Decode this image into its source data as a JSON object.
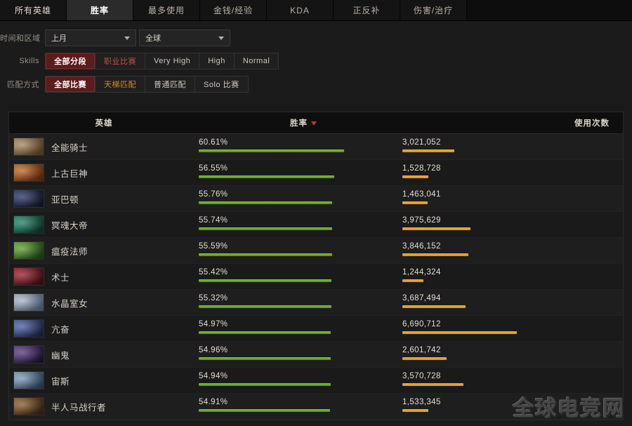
{
  "tabs": [
    {
      "label": "所有英雄",
      "active": false
    },
    {
      "label": "胜率",
      "active": true
    },
    {
      "label": "最多使用",
      "active": false
    },
    {
      "label": "金钱/经验",
      "active": false
    },
    {
      "label": "KDA",
      "active": false
    },
    {
      "label": "正反补",
      "active": false
    },
    {
      "label": "伤害/治疗",
      "active": false
    }
  ],
  "filters": {
    "time_region": {
      "label": "时间和区域",
      "period": {
        "value": "上月"
      },
      "region": {
        "value": "全球"
      }
    },
    "skills": {
      "label": "Skills",
      "options": [
        {
          "label": "全部分段",
          "state": "active"
        },
        {
          "label": "职业比赛",
          "state": "pro"
        },
        {
          "label": "Very High",
          "state": "normal"
        },
        {
          "label": "High",
          "state": "normal"
        },
        {
          "label": "Normal",
          "state": "normal"
        }
      ]
    },
    "mode": {
      "label": "匹配方式",
      "options": [
        {
          "label": "全部比赛",
          "state": "active"
        },
        {
          "label": "天梯匹配",
          "state": "ranked"
        },
        {
          "label": "普通匹配",
          "state": "normal"
        },
        {
          "label": "Solo 比赛",
          "state": "normal"
        }
      ]
    }
  },
  "table": {
    "columns": {
      "hero": "英雄",
      "winrate": "胜率",
      "usage": "使用次数",
      "sort_icon": "sort-desc-icon"
    },
    "rows": [
      {
        "hero": "全能骑士",
        "winrate": "60.61%",
        "winrate_value": 60.61,
        "usage": "3,021,052",
        "usage_value": 3021052,
        "portrait_a": "#c9a878",
        "portrait_b": "#6b4a2c"
      },
      {
        "hero": "上古巨神",
        "winrate": "56.55%",
        "winrate_value": 56.55,
        "usage": "1,528,728",
        "usage_value": 1528728,
        "portrait_a": "#e0882e",
        "portrait_b": "#7a2a14"
      },
      {
        "hero": "亚巴顿",
        "winrate": "55.76%",
        "winrate_value": 55.76,
        "usage": "1,463,041",
        "usage_value": 1463041,
        "portrait_a": "#3c4a86",
        "portrait_b": "#16182e"
      },
      {
        "hero": "冥魂大帝",
        "winrate": "55.74%",
        "winrate_value": 55.74,
        "usage": "3,975,629",
        "usage_value": 3975629,
        "portrait_a": "#2fa98a",
        "portrait_b": "#123a2c"
      },
      {
        "hero": "瘟疫法师",
        "winrate": "55.59%",
        "winrate_value": 55.59,
        "usage": "3,846,152",
        "usage_value": 3846152,
        "portrait_a": "#7ec942",
        "portrait_b": "#1e4a18"
      },
      {
        "hero": "术士",
        "winrate": "55.42%",
        "winrate_value": 55.42,
        "usage": "1,244,324",
        "usage_value": 1244324,
        "portrait_a": "#c0303a",
        "portrait_b": "#45101a"
      },
      {
        "hero": "水晶室女",
        "winrate": "55.32%",
        "winrate_value": 55.32,
        "usage": "3,687,494",
        "usage_value": 3687494,
        "portrait_a": "#cfd8e6",
        "portrait_b": "#5a7390"
      },
      {
        "hero": "亢奋",
        "winrate": "54.97%",
        "winrate_value": 54.97,
        "usage": "6,690,712",
        "usage_value": 6690712,
        "portrait_a": "#5c7fd0",
        "portrait_b": "#1d2448"
      },
      {
        "hero": "幽鬼",
        "winrate": "54.96%",
        "winrate_value": 54.96,
        "usage": "2,601,742",
        "usage_value": 2601742,
        "portrait_a": "#7a4fa8",
        "portrait_b": "#1a1430"
      },
      {
        "hero": "宙斯",
        "winrate": "54.94%",
        "winrate_value": 54.94,
        "usage": "3,570,728",
        "usage_value": 3570728,
        "portrait_a": "#9ec4e4",
        "portrait_b": "#2c4566"
      },
      {
        "hero": "半人马战行者",
        "winrate": "54.91%",
        "winrate_value": 54.91,
        "usage": "1,533,345",
        "usage_value": 1533345,
        "portrait_a": "#b07a3c",
        "portrait_b": "#3c2412"
      }
    ],
    "winrate_bar_max": 61.5,
    "usage_bar_max": 7600000
  },
  "watermark": {
    "text": "全球电竞网"
  },
  "colors": {
    "accent_active": "#5d1b1b",
    "bar_green": "#8ec63f",
    "bar_orange": "#f0b23a",
    "sort_red": "#c0392b"
  }
}
